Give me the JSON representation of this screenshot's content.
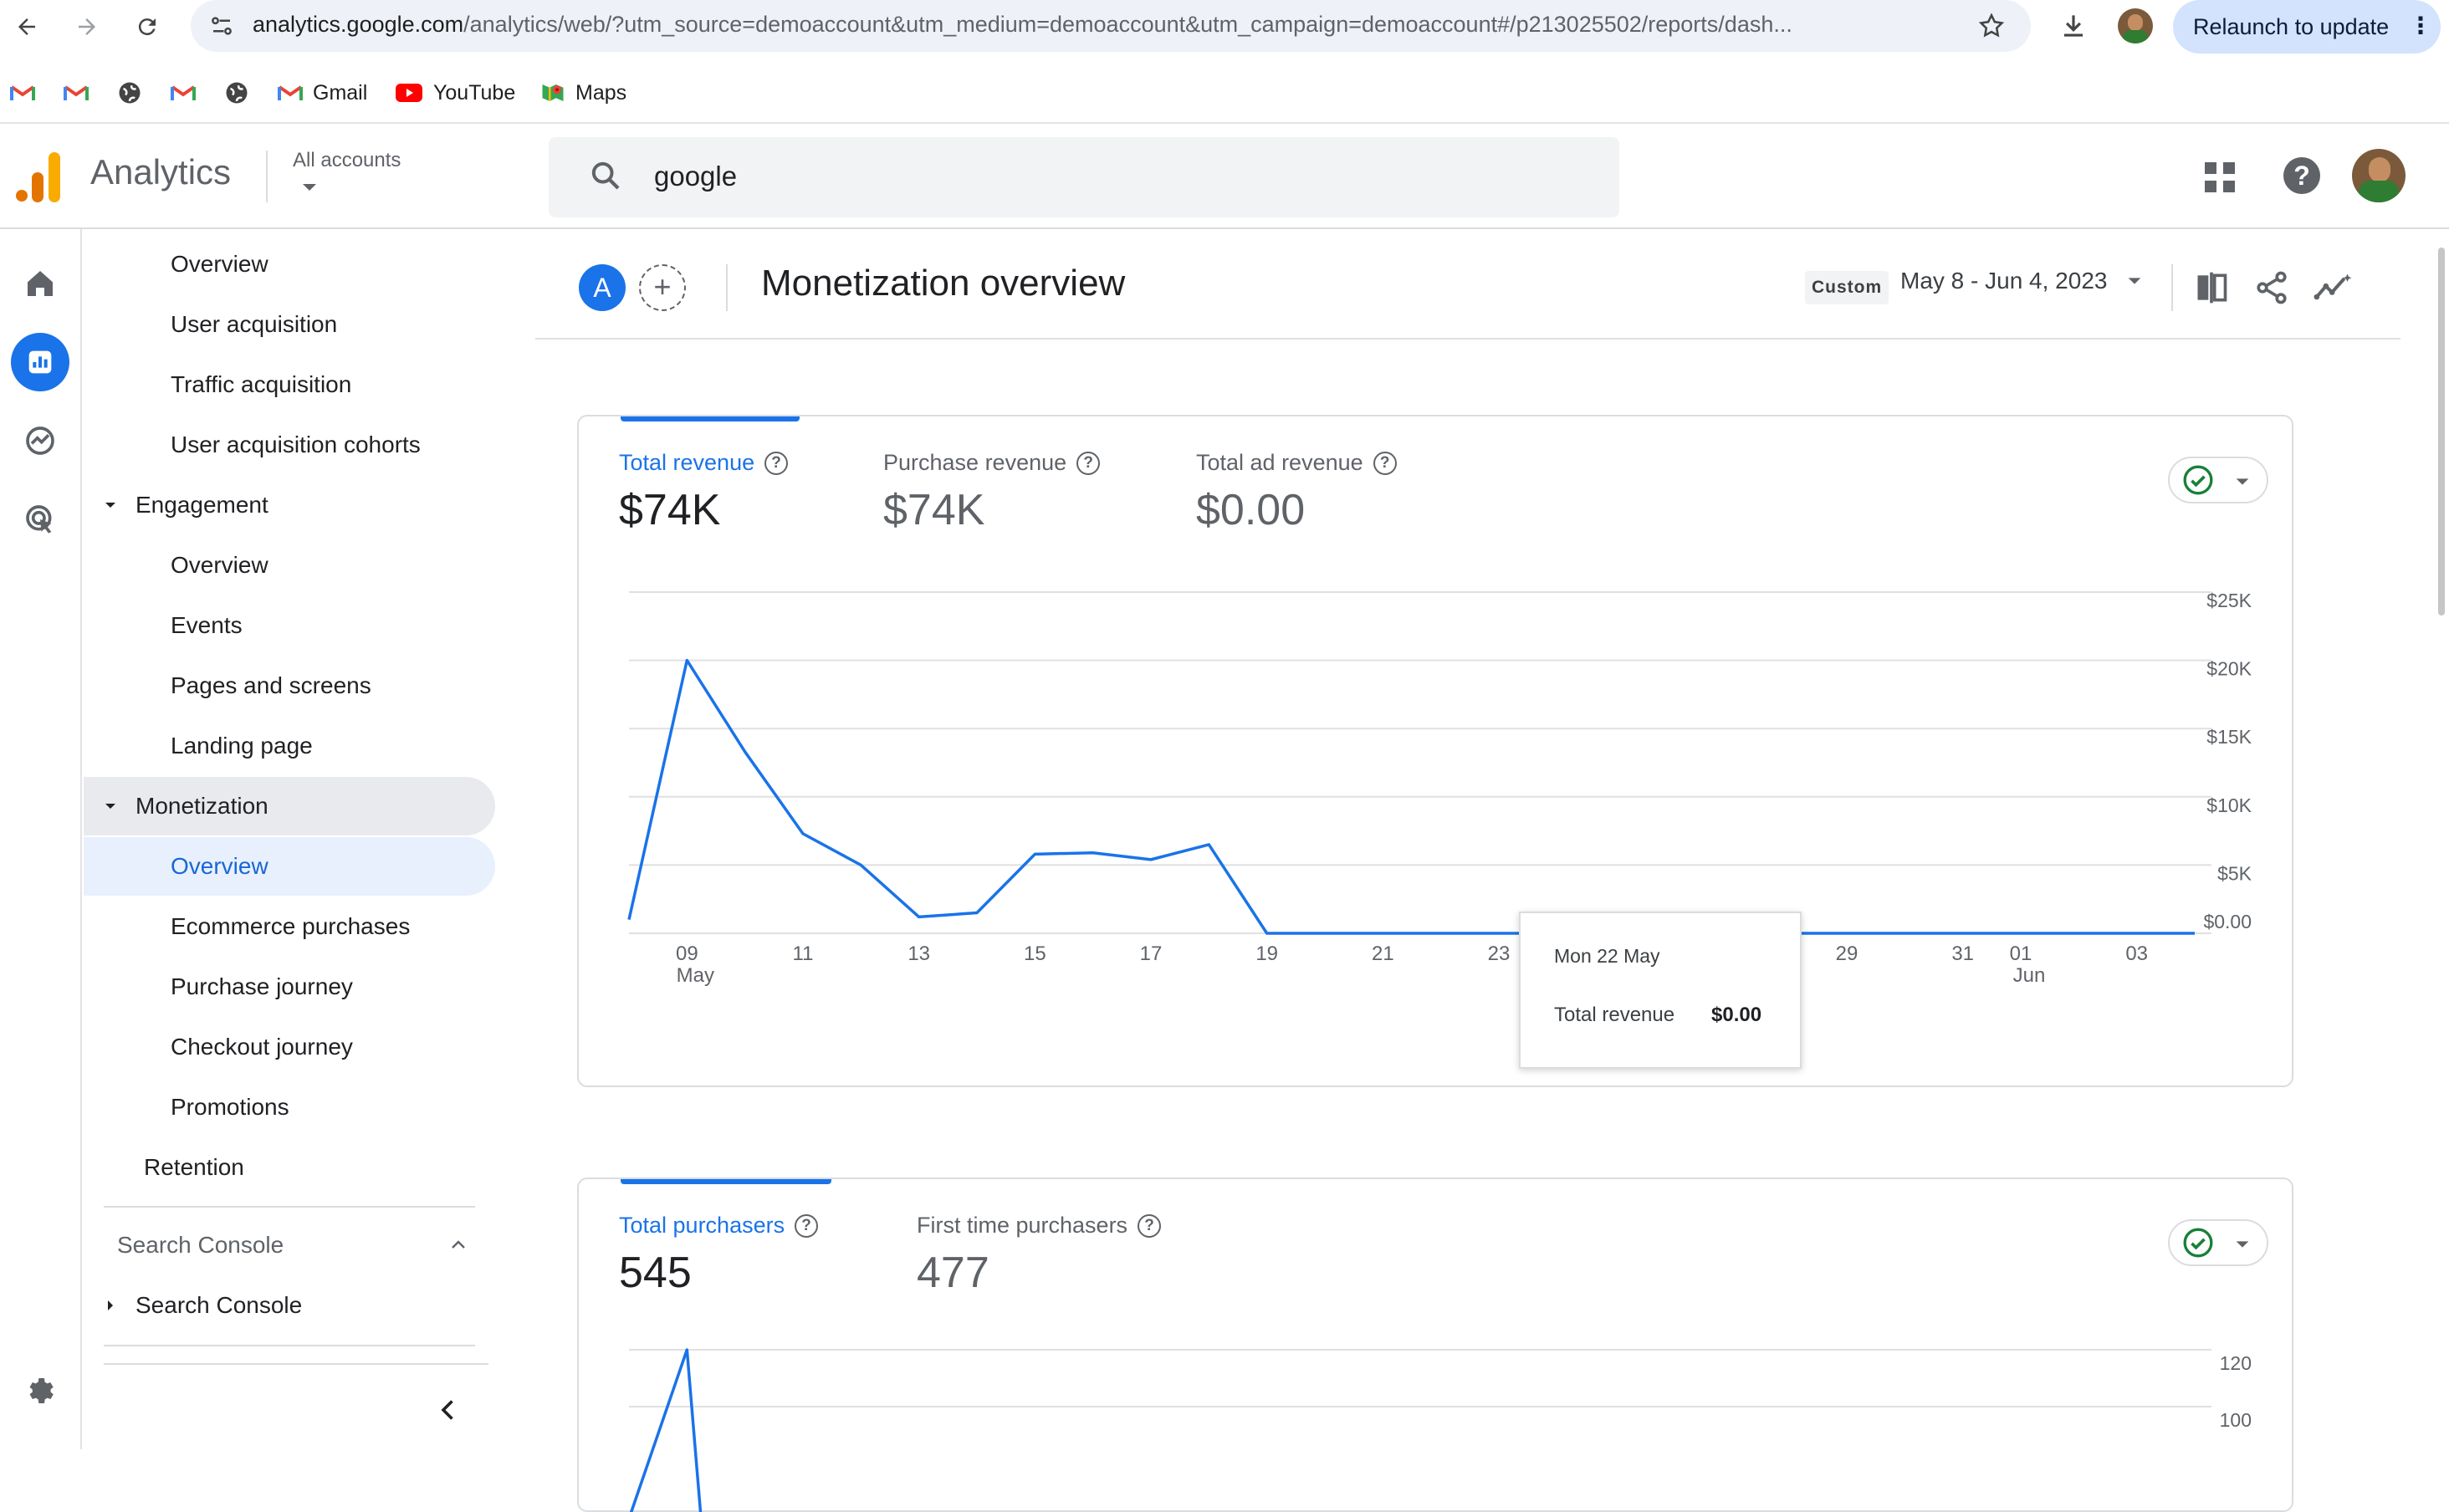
{
  "browser": {
    "url_host": "analytics.google.com",
    "url_path": "/analytics/web/?utm_source=demoaccount&utm_medium=demoaccount&utm_campaign=demoaccount#/p213025502/reports/dash...",
    "relaunch_label": "Relaunch to update",
    "bookmarks": [
      {
        "name": "gmail-bookmark-1",
        "label": ""
      },
      {
        "name": "gmail-bookmark-2",
        "label": ""
      },
      {
        "name": "globe-bookmark-1",
        "label": ""
      },
      {
        "name": "gmail-bookmark-3",
        "label": ""
      },
      {
        "name": "globe-bookmark-2",
        "label": ""
      },
      {
        "name": "gmail-bookmark",
        "label": "Gmail"
      },
      {
        "name": "youtube-bookmark",
        "label": "YouTube"
      },
      {
        "name": "maps-bookmark",
        "label": "Maps"
      }
    ]
  },
  "header": {
    "product": "Analytics",
    "account_label": "All accounts",
    "search_value": "google"
  },
  "nav": {
    "items": [
      {
        "label": "Overview",
        "level": 2
      },
      {
        "label": "User acquisition",
        "level": 2
      },
      {
        "label": "Traffic acquisition",
        "level": 2
      },
      {
        "label": "User acquisition cohorts",
        "level": 2
      },
      {
        "label": "Engagement",
        "level": 1
      },
      {
        "label": "Overview",
        "level": 2
      },
      {
        "label": "Events",
        "level": 2
      },
      {
        "label": "Pages and screens",
        "level": 2
      },
      {
        "label": "Landing page",
        "level": 2
      },
      {
        "label": "Monetization",
        "level": 1
      },
      {
        "label": "Overview",
        "level": 2
      },
      {
        "label": "Ecommerce purchases",
        "level": 2
      },
      {
        "label": "Purchase journey",
        "level": 2
      },
      {
        "label": "Checkout journey",
        "level": 2
      },
      {
        "label": "Promotions",
        "level": 2
      },
      {
        "label": "Retention",
        "level": 1
      }
    ],
    "section_title": "Search Console",
    "section_item": "Search Console"
  },
  "page": {
    "avatar_letter": "A",
    "title": "Monetization overview",
    "date_chip": "Custom",
    "date_range": "May 8 - Jun 4, 2023"
  },
  "card1": {
    "metrics": [
      {
        "label": "Total revenue",
        "value": "$74K",
        "active": true
      },
      {
        "label": "Purchase revenue",
        "value": "$74K",
        "active": false
      },
      {
        "label": "Total ad revenue",
        "value": "$0.00",
        "active": false
      }
    ],
    "tooltip": {
      "date": "Mon 22 May",
      "metric": "Total revenue",
      "value": "$0.00"
    }
  },
  "card2": {
    "metrics": [
      {
        "label": "Total purchasers",
        "value": "545",
        "active": true
      },
      {
        "label": "First time purchasers",
        "value": "477",
        "active": false
      }
    ],
    "y_ticks": [
      "120",
      "100"
    ]
  },
  "colors": {
    "accent": "#1a73e8",
    "line": "#1a73e8",
    "selected_bg": "#e8f0fe"
  },
  "chart_data": [
    {
      "type": "line",
      "title": "",
      "series": [
        {
          "name": "Total revenue",
          "values": [
            1000,
            20000,
            13300,
            7300,
            5000,
            1200,
            1500,
            5800,
            5900,
            5400,
            6500,
            0,
            0,
            0,
            0,
            0,
            0,
            0,
            0,
            0,
            0,
            0,
            0,
            0,
            0,
            0,
            0,
            0
          ]
        }
      ],
      "x": [
        "08",
        "09",
        "10",
        "11",
        "12",
        "13",
        "14",
        "15",
        "16",
        "17",
        "18",
        "19",
        "20",
        "21",
        "22",
        "23",
        "24",
        "25",
        "26",
        "27",
        "28",
        "29",
        "30",
        "31",
        "01",
        "02",
        "03",
        "04"
      ],
      "x_tick_labels": [
        "09",
        "11",
        "13",
        "15",
        "17",
        "19",
        "21",
        "23",
        "25",
        "27",
        "29",
        "31",
        "01",
        "03"
      ],
      "x_sub_labels": {
        "09": "May",
        "01": "Jun"
      },
      "y_tick_labels": [
        "$25K",
        "$20K",
        "$15K",
        "$10K",
        "$5K",
        "$0.00"
      ],
      "ylim": [
        0,
        25000
      ],
      "grid": true
    },
    {
      "type": "line",
      "series": [
        {
          "name": "Total purchasers",
          "values": [
            90,
            120
          ]
        }
      ],
      "x": [
        "08",
        "09"
      ],
      "y_tick_labels": [
        "120",
        "100"
      ]
    }
  ]
}
